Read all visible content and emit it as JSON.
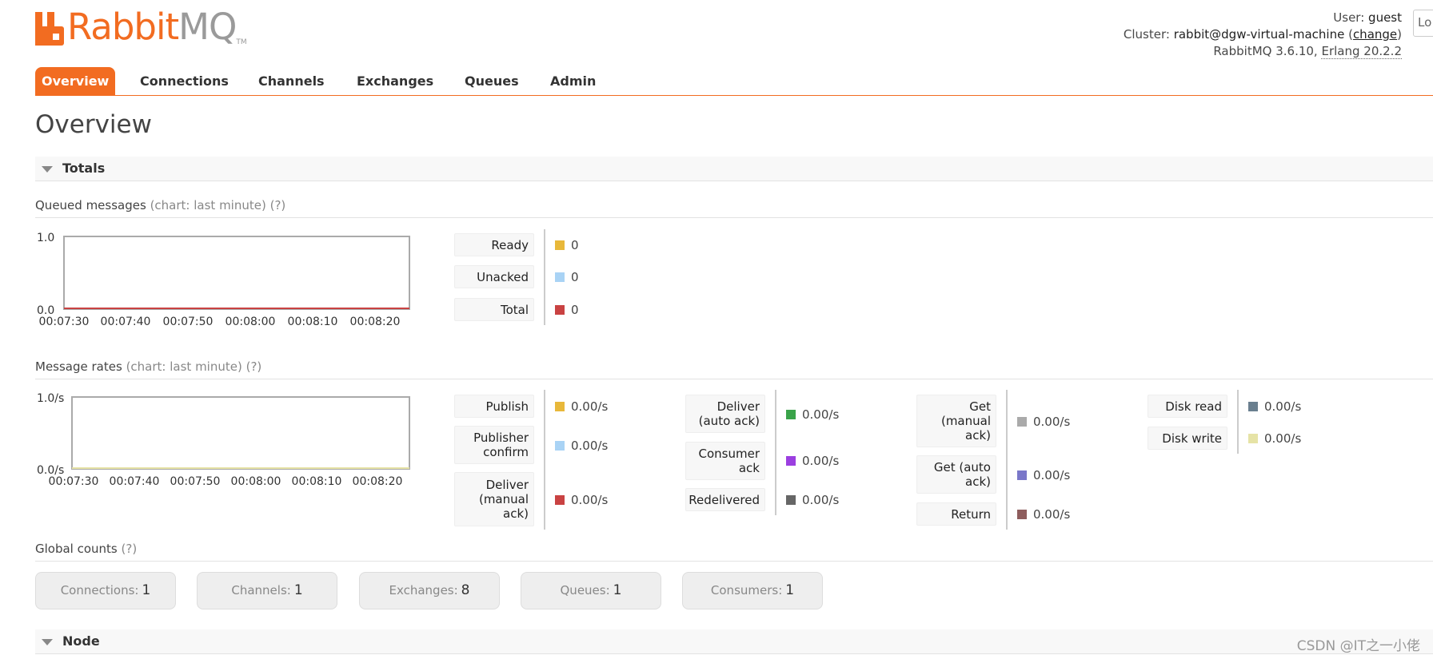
{
  "header": {
    "logo_text_rabbit": "Rabbit",
    "logo_text_mq": "MQ",
    "logo_tm": "TM",
    "user_label": "User:",
    "user_name": "guest",
    "cluster_label": "Cluster:",
    "cluster_name": "rabbit@dgw-virtual-machine",
    "cluster_change": "change",
    "version_text": "RabbitMQ 3.6.10,",
    "erlang_text": "Erlang 20.2.2",
    "logout_label": "Lo"
  },
  "tabs": [
    {
      "label": "Overview",
      "active": true
    },
    {
      "label": "Connections"
    },
    {
      "label": "Channels"
    },
    {
      "label": "Exchanges"
    },
    {
      "label": "Queues"
    },
    {
      "label": "Admin"
    }
  ],
  "page_title": "Overview",
  "totals": {
    "title": "Totals",
    "queued": {
      "title": "Queued messages",
      "chart_note": "(chart: last minute)",
      "help": "(?)",
      "legend": [
        {
          "label": "Ready",
          "value": "0",
          "color": "#e8b83a"
        },
        {
          "label": "Unacked",
          "value": "0",
          "color": "#a9d3f5"
        },
        {
          "label": "Total",
          "value": "0",
          "color": "#c94242"
        }
      ]
    },
    "rates": {
      "title": "Message rates",
      "chart_note": "(chart: last minute)",
      "help": "(?)",
      "legend_col1": [
        {
          "label": "Publish",
          "value": "0.00/s",
          "color": "#e8b83a"
        },
        {
          "label": "Publisher confirm",
          "value": "0.00/s",
          "color": "#a9d3f5"
        },
        {
          "label": "Deliver (manual ack)",
          "value": "0.00/s",
          "color": "#c94242"
        }
      ],
      "legend_col2": [
        {
          "label": "Deliver (auto ack)",
          "value": "0.00/s",
          "color": "#3aa34a"
        },
        {
          "label": "Consumer ack",
          "value": "0.00/s",
          "color": "#9b3fe0"
        },
        {
          "label": "Redelivered",
          "value": "0.00/s",
          "color": "#666666"
        }
      ],
      "legend_col3": [
        {
          "label": "Get (manual ack)",
          "value": "0.00/s",
          "color": "#aaaaaa"
        },
        {
          "label": "Get (auto ack)",
          "value": "0.00/s",
          "color": "#7a77c9"
        },
        {
          "label": "Return",
          "value": "0.00/s",
          "color": "#8e5d5d"
        }
      ],
      "legend_col4": [
        {
          "label": "Disk read",
          "value": "0.00/s",
          "color": "#6a7f8f"
        },
        {
          "label": "Disk write",
          "value": "0.00/s",
          "color": "#e6e3a6"
        }
      ]
    },
    "global": {
      "title": "Global counts",
      "help": "(?)",
      "items": [
        {
          "label": "Connections:",
          "value": "1"
        },
        {
          "label": "Channels:",
          "value": "1"
        },
        {
          "label": "Exchanges:",
          "value": "8"
        },
        {
          "label": "Queues:",
          "value": "1"
        },
        {
          "label": "Consumers:",
          "value": "1"
        }
      ]
    }
  },
  "node": {
    "title": "Node"
  },
  "chart_data": [
    {
      "type": "line",
      "x": [
        "00:07:30",
        "00:07:40",
        "00:07:50",
        "00:08:00",
        "00:08:10",
        "00:08:20"
      ],
      "ylim": [
        0.0,
        1.0
      ],
      "ytick_labels": [
        "1.0",
        "0.0"
      ],
      "series": [
        {
          "name": "Ready",
          "values": [
            0,
            0,
            0,
            0,
            0,
            0
          ],
          "color": "#e8b83a"
        },
        {
          "name": "Unacked",
          "values": [
            0,
            0,
            0,
            0,
            0,
            0
          ],
          "color": "#a9d3f5"
        },
        {
          "name": "Total",
          "values": [
            0,
            0,
            0,
            0,
            0,
            0
          ],
          "color": "#c94242"
        }
      ]
    },
    {
      "type": "line",
      "x": [
        "00:07:30",
        "00:07:40",
        "00:07:50",
        "00:08:00",
        "00:08:10",
        "00:08:20"
      ],
      "ylim": [
        0.0,
        1.0
      ],
      "ytick_labels": [
        "1.0/s",
        "0.0/s"
      ],
      "series": [
        {
          "name": "Publish",
          "values": [
            0,
            0,
            0,
            0,
            0,
            0
          ],
          "color": "#e8b83a"
        },
        {
          "name": "Disk write",
          "values": [
            0,
            0,
            0,
            0,
            0,
            0
          ],
          "color": "#e6e3a6"
        }
      ]
    }
  ],
  "watermark": "CSDN @IT之一小佬"
}
